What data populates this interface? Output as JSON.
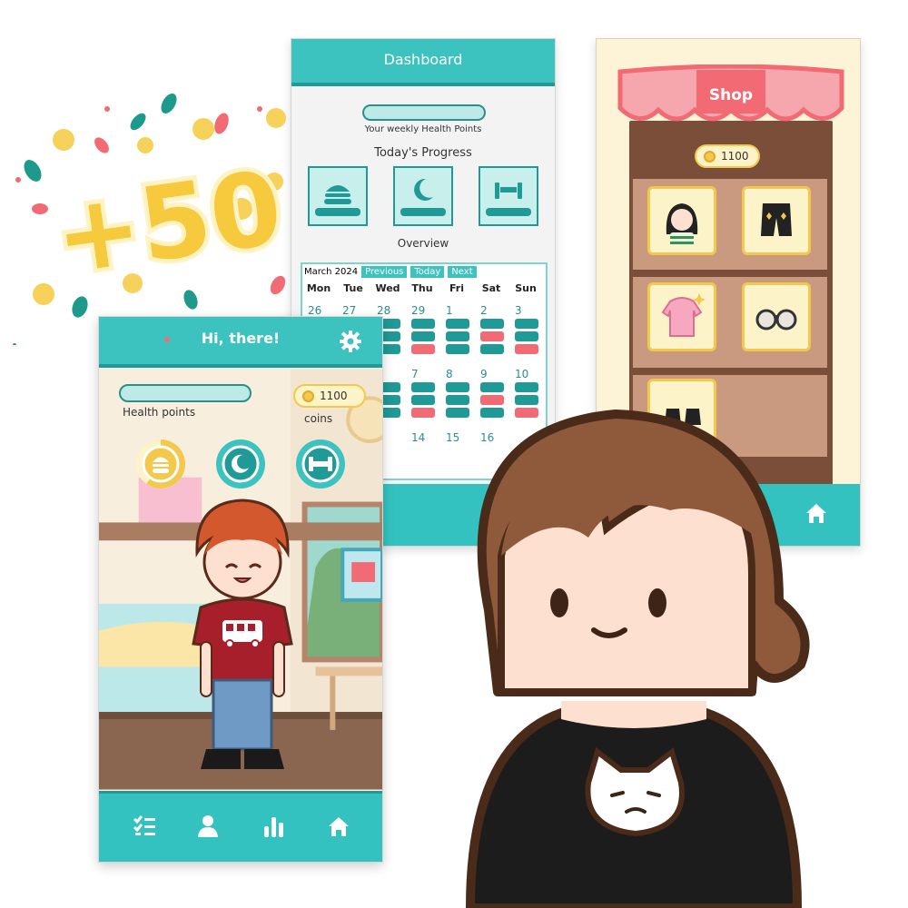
{
  "badge": {
    "text": "+50"
  },
  "colors": {
    "teal": "#3cc3bf",
    "teal_dark": "#1f9a96",
    "coral": "#f16a74",
    "gold": "#f2c94c",
    "cream": "#fdf3c8"
  },
  "home": {
    "title": "Hi, there!",
    "health_label": "Health points",
    "coins_value": "1100",
    "coins_label": "coins",
    "stats": [
      {
        "icon": "burger-icon",
        "level": 0.6
      },
      {
        "icon": "moon-icon"
      },
      {
        "icon": "dumbbell-icon"
      }
    ],
    "nav": [
      "checklist-icon",
      "person-icon",
      "bar-chart-icon",
      "home-icon"
    ]
  },
  "dashboard": {
    "title": "Dashboard",
    "health_label": "Your weekly Health Points",
    "today_progress": "Today's Progress",
    "overview": "Overview",
    "calendar": {
      "month": "March 2024",
      "buttons": [
        "Previous",
        "Today",
        "Next"
      ],
      "weekdays": [
        "Mon",
        "Tue",
        "Wed",
        "Thu",
        "Fri",
        "Sat",
        "Sun"
      ],
      "week1": [
        "26",
        "27",
        "28",
        "29",
        "1",
        "2",
        "3"
      ],
      "week2": [
        "",
        "",
        "",
        "7",
        "8",
        "9",
        "10"
      ],
      "week3": [
        "",
        "",
        "",
        "14",
        "15",
        "16",
        ""
      ]
    }
  },
  "shop": {
    "title": "Shop",
    "coins_value": "1100",
    "items": [
      "girl-avatar-item",
      "black-shorts-item",
      "pink-hoodie-item",
      "sunglasses-item",
      "black-shoes-item"
    ]
  }
}
